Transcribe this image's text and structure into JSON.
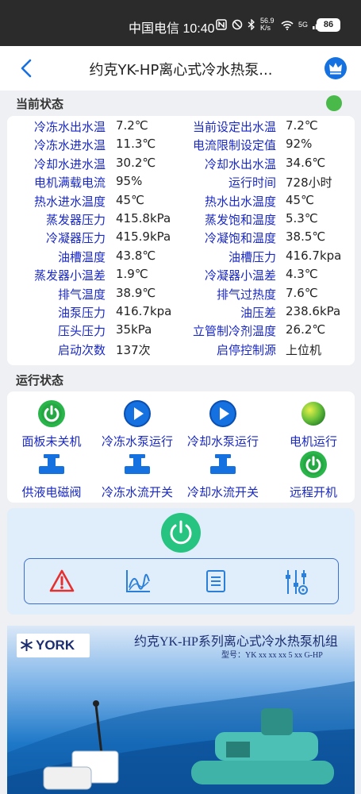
{
  "statusbar": {
    "carrier_time": "中国电信 10:40",
    "speed": "56.9 K/s",
    "net": "5G",
    "battery": "86"
  },
  "header": {
    "title": "约克YK-HP离心式冷水热泵..."
  },
  "current": {
    "title": "当前状态",
    "rows": [
      {
        "l_label": "冷冻水出水温",
        "l_value": "7.2℃",
        "r_label": "当前设定出水温",
        "r_value": "7.2℃"
      },
      {
        "l_label": "冷冻水进水温",
        "l_value": "11.3℃",
        "r_label": "电流限制设定值",
        "r_value": "92%"
      },
      {
        "l_label": "冷却水进水温",
        "l_value": "30.2℃",
        "r_label": "冷却水出水温",
        "r_value": "34.6℃"
      },
      {
        "l_label": "电机满载电流",
        "l_value": "95%",
        "r_label": "运行时间",
        "r_value": "728小时"
      },
      {
        "l_label": "热水进水温度",
        "l_value": "45℃",
        "r_label": "热水出水温度",
        "r_value": "45℃"
      },
      {
        "l_label": "蒸发器压力",
        "l_value": "415.8kPa",
        "r_label": "蒸发饱和温度",
        "r_value": "5.3℃"
      },
      {
        "l_label": "冷凝器压力",
        "l_value": "415.9kPa",
        "r_label": "冷凝饱和温度",
        "r_value": "38.5℃"
      },
      {
        "l_label": "油槽温度",
        "l_value": "43.8℃",
        "r_label": "油槽压力",
        "r_value": "416.7kpa"
      },
      {
        "l_label": "蒸发器小温差",
        "l_value": "1.9℃",
        "r_label": "冷凝器小温差",
        "r_value": "4.3℃"
      },
      {
        "l_label": "排气温度",
        "l_value": "38.9℃",
        "r_label": "排气过热度",
        "r_value": "7.6℃"
      },
      {
        "l_label": "油泵压力",
        "l_value": "416.7kpa",
        "r_label": "油压差",
        "r_value": "238.6kPa"
      },
      {
        "l_label": "压头压力",
        "l_value": "35kPa",
        "r_label": "立管制冷剂温度",
        "r_value": "26.2℃"
      },
      {
        "l_label": "启动次数",
        "l_value": "137次",
        "r_label": "启停控制源",
        "r_value": "上位机"
      }
    ]
  },
  "running": {
    "title": "运行状态",
    "items": [
      {
        "label": "面板未关机",
        "icon": "power-icon"
      },
      {
        "label": "冷冻水泵运行",
        "icon": "play-icon"
      },
      {
        "label": "冷却水泵运行",
        "icon": "play-icon"
      },
      {
        "label": "电机运行",
        "icon": "motor-icon"
      },
      {
        "label": "供液电磁阀",
        "icon": "valve-icon"
      },
      {
        "label": "冷冻水流开关",
        "icon": "valve-icon"
      },
      {
        "label": "冷却水流开关",
        "icon": "valve-icon"
      },
      {
        "label": "远程开机",
        "icon": "power-icon"
      }
    ]
  },
  "banner": {
    "logo": "YORK",
    "title": "约克YK-HP系列离心式冷水热泵机组",
    "model": "型号：YK xx xx  xx 5 xx G-HP"
  },
  "colors": {
    "label_blue": "#1a29c4",
    "status_green": "#49b94a",
    "accent_blue": "#1570e0"
  }
}
